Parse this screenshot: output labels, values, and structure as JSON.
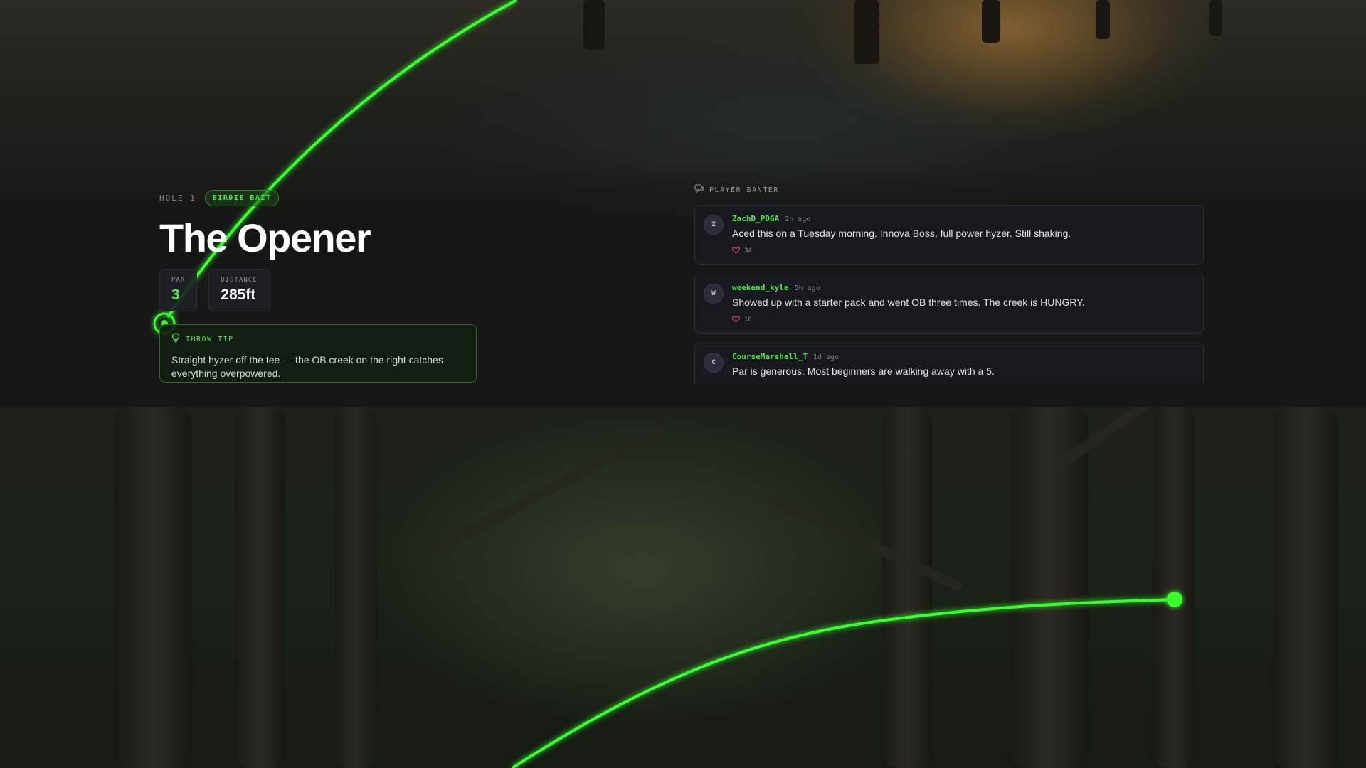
{
  "hole": {
    "label": "HOLE 1",
    "badge": "BIRDIE BAIT",
    "name": "The Opener",
    "stats": [
      {
        "label": "PAR",
        "value": "3"
      },
      {
        "label": "DISTANCE",
        "value": "285ft"
      }
    ]
  },
  "tip": {
    "title": "THROW TIP",
    "icon": "lightbulb-icon",
    "text": "Straight hyzer off the tee — the OB creek on the right catches everything overpowered."
  },
  "banter": {
    "title": "PLAYER BANTER",
    "icon": "chat-icon",
    "comments": [
      {
        "initial": "Z",
        "user": "ZachD_PDGA",
        "time": "2h ago",
        "text": "Aced this on a Tuesday morning. Innova Boss, full power hyzer. Still shaking.",
        "likes": "34"
      },
      {
        "initial": "W",
        "user": "weekend_kyle",
        "time": "5h ago",
        "text": "Showed up with a starter pack and went OB three times. The creek is HUNGRY.",
        "likes": "18"
      },
      {
        "initial": "C",
        "user": "CourseMarshall_T",
        "time": "1d ago",
        "text": "Par is generous. Most beginners are walking away with a 5.",
        "likes": ""
      }
    ]
  },
  "colors": {
    "accent": "#4ee84a",
    "heart": "#e0447a",
    "panel": "#181820"
  }
}
